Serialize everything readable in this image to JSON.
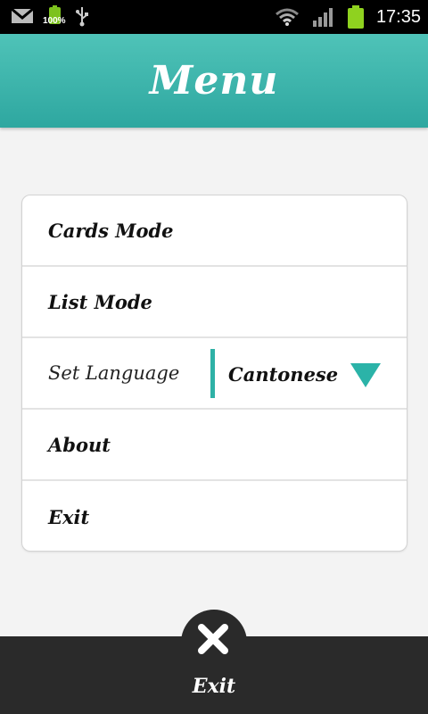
{
  "status_bar": {
    "battery_percent": "100%",
    "time": "17:35",
    "icons": [
      "gmail-icon",
      "battery-icon",
      "usb-icon",
      "wifi-icon",
      "signal-icon",
      "battery-icon"
    ],
    "battery_color": "#8fd21f"
  },
  "header": {
    "title": "Menu",
    "color": "#36b0a8"
  },
  "menu": {
    "items": [
      {
        "label": "Cards Mode"
      },
      {
        "label": "List Mode"
      },
      {
        "label": "Set Language",
        "value": "Cantonese"
      },
      {
        "label": "About"
      },
      {
        "label": "Exit"
      }
    ],
    "accent_color": "#2bb3a8"
  },
  "bottom_bar": {
    "exit_label": "Exit"
  }
}
